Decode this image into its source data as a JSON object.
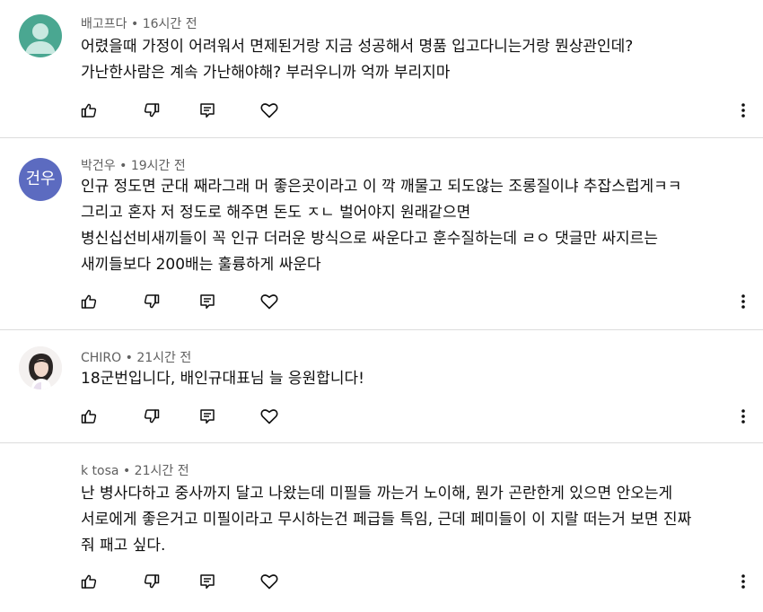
{
  "comments": [
    {
      "author": "배고프다",
      "time": "16시간 전",
      "avatar_icon": "person-icon",
      "avatar_color": "#4aa791",
      "lines": [
        "어렸을때 가정이 어려워서 면제된거랑 지금 성공해서 명품 입고다니는거랑 뭔상관인데?",
        "가난한사람은 계속 가난해야해? 부러우니까 억까 부리지마"
      ]
    },
    {
      "author": "박건우",
      "time": "19시간 전",
      "avatar_text": "건우",
      "avatar_color": "#5c6bc0",
      "lines": [
        "인규 정도면 군대 째라그래 머 좋은곳이라고 이 깍 깨물고 되도않는 조롱질이냐 추잡스럽게ㅋㅋ",
        "그리고 혼자 저 정도로 해주면 돈도 ㅈㄴ 벌어야지 원래같으면",
        "병신십선비새끼들이 꼭 인규 더러운 방식으로 싸운다고 훈수질하는데 ㄹㅇ 댓글만 싸지르는",
        "새끼들보다 200배는 훌륭하게 싸운다"
      ]
    },
    {
      "author": "CHIRO",
      "time": "21시간 전",
      "avatar_icon": "profile-photo",
      "lines": [
        "18군번입니다, 배인규대표님 늘 응원합니다!"
      ]
    },
    {
      "author": "k tosa",
      "time": "21시간 전",
      "lines": [
        "난 병사다하고 중사까지 달고 나왔는데 미필들 까는거 노이해, 뭔가 곤란한게 있으면 안오는게",
        "서로에게 좋은거고 미필이라고 무시하는건 페급들 특임, 근데 페미들이 이 지랄 떠는거 보면 진짜",
        "줘 패고 싶다."
      ]
    }
  ],
  "separator": " • ",
  "icons": {
    "like": "thumbs-up-icon",
    "dislike": "thumbs-down-icon",
    "reply": "reply-icon",
    "heart": "heart-icon",
    "more": "more-vert-icon"
  }
}
